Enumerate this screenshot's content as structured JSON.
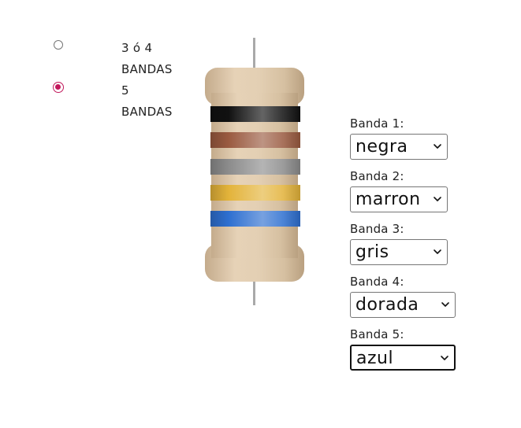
{
  "band_mode": {
    "options": [
      {
        "line1": "3 ó 4",
        "line2": "BANDAS",
        "selected": false
      },
      {
        "line1": "5",
        "line2": "BANDAS",
        "selected": true
      }
    ]
  },
  "resistor": {
    "body_color": "#dcc6a8",
    "lead_color": "#a9a9a9",
    "bands": [
      {
        "name": "negra",
        "color": "#111111"
      },
      {
        "name": "marron",
        "color": "#9a5a40"
      },
      {
        "name": "gris",
        "color": "#8c8c8c"
      },
      {
        "name": "dorada",
        "color": "#e3b33a"
      },
      {
        "name": "azul",
        "color": "#2e6fd0"
      }
    ]
  },
  "selectors": [
    {
      "label": "Banda 1:",
      "value": "negra"
    },
    {
      "label": "Banda 2:",
      "value": "marron"
    },
    {
      "label": "Banda 3:",
      "value": "gris"
    },
    {
      "label": "Banda 4:",
      "value": "dorada"
    },
    {
      "label": "Banda 5:",
      "value": "azul"
    }
  ],
  "icons": {
    "select_arrow": "chevron-down-icon"
  }
}
